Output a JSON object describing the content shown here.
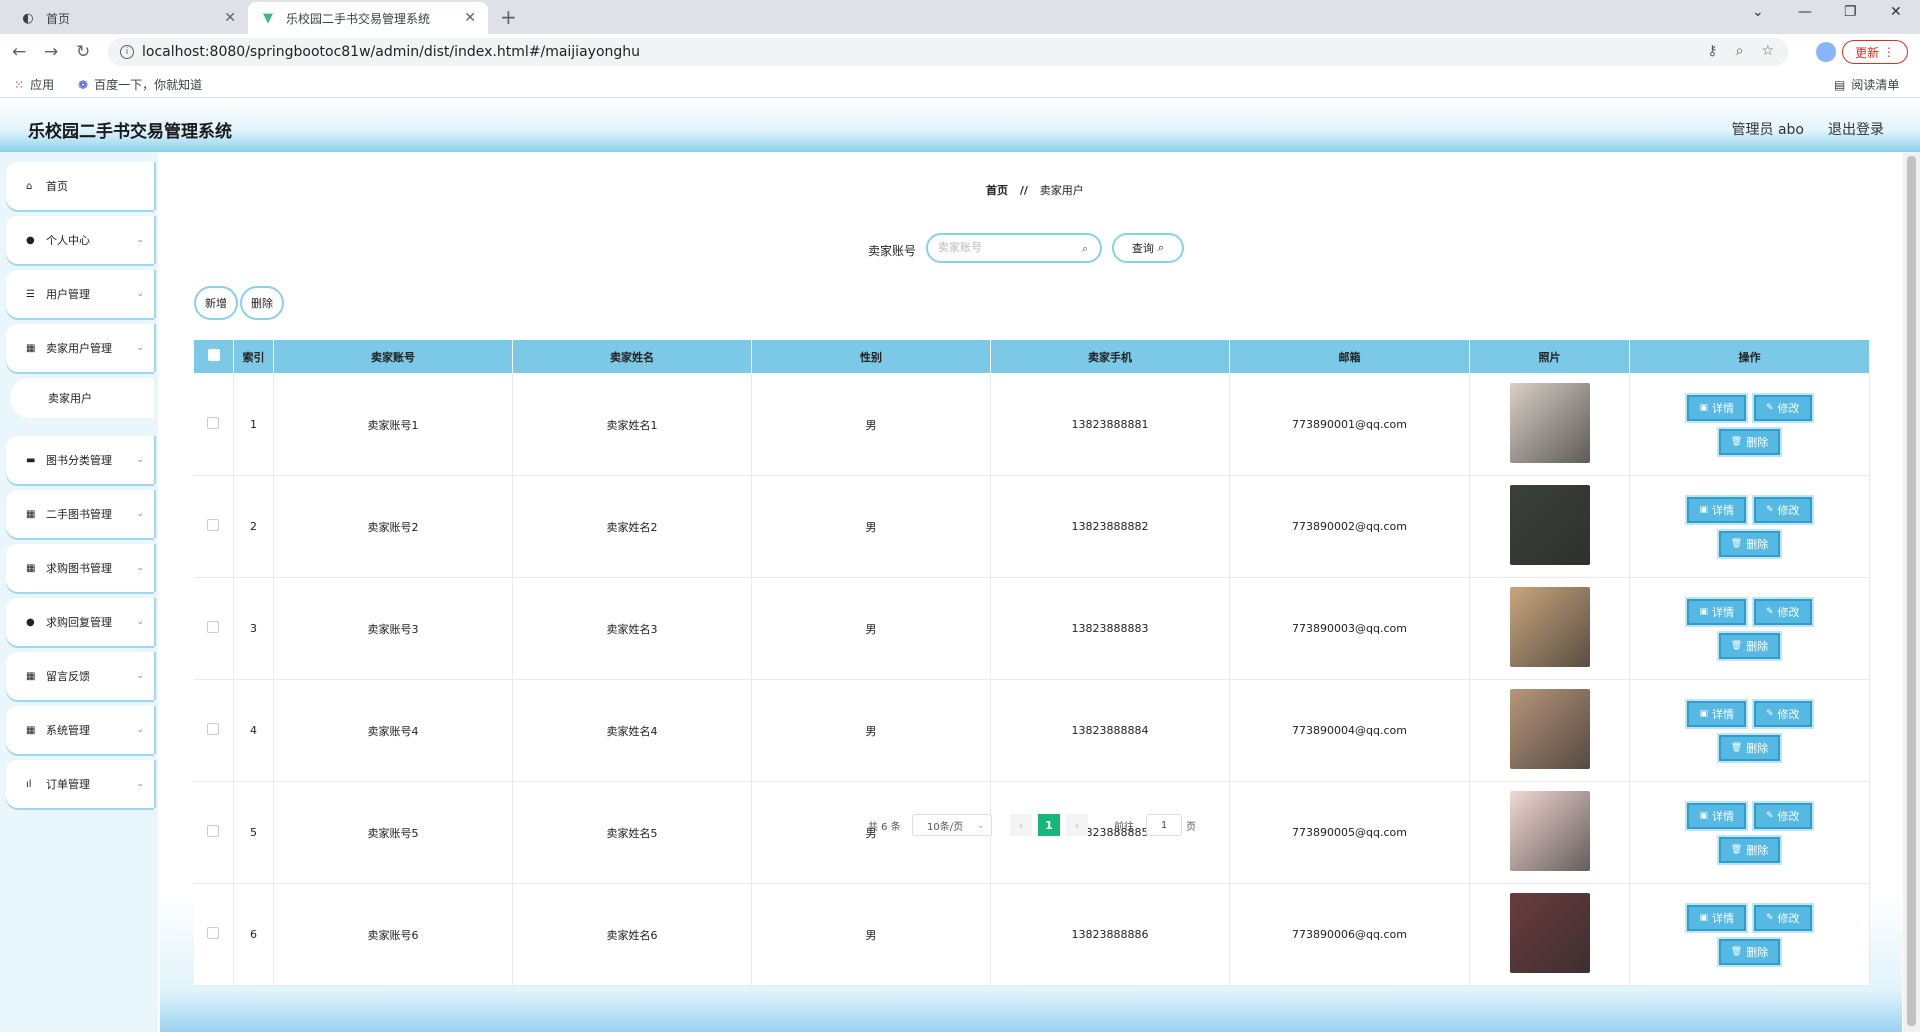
{
  "browser": {
    "tabs": [
      {
        "title": "首页",
        "active": false
      },
      {
        "title": "乐校园二手书交易管理系统",
        "active": true
      }
    ],
    "url": "localhost:8080/springbootoc81w/admin/dist/index.html#/maijiayonghu",
    "update_label": "更新",
    "bookmarks": [
      {
        "label": "应用",
        "icon": "apps-grid-icon"
      },
      {
        "label": "百度一下，你就知道",
        "icon": "baidu-paw-icon"
      }
    ],
    "reading_list": "阅读清单"
  },
  "header": {
    "title": "乐校园二手书交易管理系统",
    "admin": "管理员 abo",
    "logout": "退出登录"
  },
  "sidebar": {
    "items": [
      {
        "label": "首页",
        "icon": "home-icon",
        "has_children": false
      },
      {
        "label": "个人中心",
        "icon": "user-icon",
        "has_children": true
      },
      {
        "label": "用户管理",
        "icon": "sliders-icon",
        "has_children": true
      },
      {
        "label": "卖家用户管理",
        "icon": "grid-icon",
        "has_children": true,
        "expanded": true
      },
      {
        "label": "卖家用户",
        "icon": "",
        "sub": true
      },
      {
        "label": "图书分类管理",
        "icon": "book-icon",
        "has_children": true
      },
      {
        "label": "二手图书管理",
        "icon": "grid-icon",
        "has_children": true
      },
      {
        "label": "求购图书管理",
        "icon": "grid-icon",
        "has_children": true
      },
      {
        "label": "求购回复管理",
        "icon": "user-icon",
        "has_children": true
      },
      {
        "label": "留言反馈",
        "icon": "grid-icon",
        "has_children": true
      },
      {
        "label": "系统管理",
        "icon": "grid-icon",
        "has_children": true
      },
      {
        "label": "订单管理",
        "icon": "bar-chart-icon",
        "has_children": true
      }
    ]
  },
  "breadcrumb": {
    "home": "首页",
    "sep": "//",
    "current": "卖家用户"
  },
  "search": {
    "label": "卖家账号",
    "placeholder": "卖家账号",
    "query_label": "查询"
  },
  "actions": {
    "add": "新增",
    "delete": "删除"
  },
  "table": {
    "headers": [
      "索引",
      "卖家账号",
      "卖家姓名",
      "性别",
      "卖家手机",
      "邮箱",
      "照片",
      "操作"
    ],
    "op_labels": {
      "detail": "详情",
      "edit": "修改",
      "delete": "删除"
    },
    "rows": [
      {
        "index": "1",
        "account": "卖家账号1",
        "name": "卖家姓名1",
        "gender": "男",
        "phone": "13823888881",
        "email": "773890001@qq.com",
        "photo_color": "#d9cfc6"
      },
      {
        "index": "2",
        "account": "卖家账号2",
        "name": "卖家姓名2",
        "gender": "男",
        "phone": "13823888882",
        "email": "773890002@qq.com",
        "photo_color": "#3b3f3a"
      },
      {
        "index": "3",
        "account": "卖家账号3",
        "name": "卖家姓名3",
        "gender": "男",
        "phone": "13823888883",
        "email": "773890003@qq.com",
        "photo_color": "#c9a57c"
      },
      {
        "index": "4",
        "account": "卖家账号4",
        "name": "卖家姓名4",
        "gender": "男",
        "phone": "13823888884",
        "email": "773890004@qq.com",
        "photo_color": "#b8967a"
      },
      {
        "index": "5",
        "account": "卖家账号5",
        "name": "卖家姓名5",
        "gender": "男",
        "phone": "13823888885",
        "email": "773890005@qq.com",
        "photo_color": "#f1d8d2"
      },
      {
        "index": "6",
        "account": "卖家账号6",
        "name": "卖家姓名6",
        "gender": "男",
        "phone": "13823888886",
        "email": "773890006@qq.com",
        "photo_color": "#6a3b3d"
      }
    ]
  },
  "pagination": {
    "total": "共 6 条",
    "page_size": "10条/页",
    "current_page": "1",
    "goto_label": "前往",
    "goto_value": "1",
    "page_suffix": "页"
  },
  "colors": {
    "accent": "#7cc9e7",
    "button": "#56b9e3",
    "pager_active": "#16b777"
  }
}
